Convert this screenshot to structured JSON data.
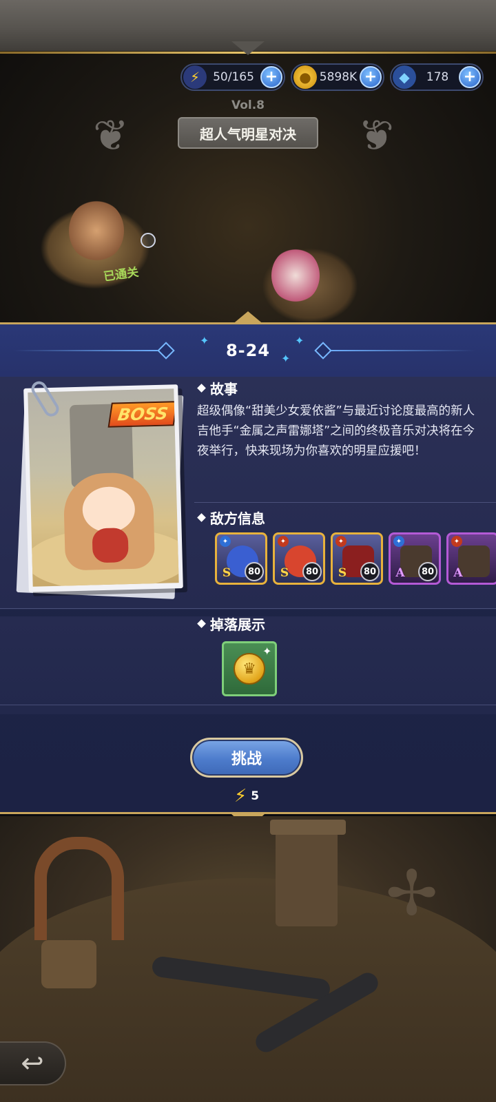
{
  "currency": {
    "energy": "50/165",
    "gold": "5898K",
    "gems": "178"
  },
  "chapter": {
    "volume": "Vol.8",
    "name": "超人气明星对决"
  },
  "map": {
    "cleared_label": "已通关"
  },
  "stage": {
    "id": "8-24",
    "boss_tag": "BOSS",
    "story_heading": "故事",
    "story_text": "超级偶像“甜美少女爱依酱”与最近讨论度最高的新人吉他手“金属之声雷娜塔”之间的终极音乐对决将在今夜举行，快来现场为你喜欢的明星应援吧！",
    "enemy_heading": "敌方信息",
    "enemies": [
      {
        "rank": "S",
        "level": "80",
        "frame": "gold",
        "portrait_color": "#3a5fd1"
      },
      {
        "rank": "S",
        "level": "80",
        "frame": "gold",
        "portrait_color": "#d8452e"
      },
      {
        "rank": "S",
        "level": "80",
        "frame": "gold",
        "portrait_color": "#8b1f1f"
      },
      {
        "rank": "A",
        "level": "80",
        "frame": "purple",
        "portrait_color": "#4a3a2e"
      },
      {
        "rank": "A",
        "level": "",
        "frame": "purple",
        "portrait_color": "#4a3a2e"
      }
    ],
    "drop_heading": "掉落展示",
    "drops": [
      {
        "icon": "gold-coin-icon"
      }
    ],
    "challenge_label": "挑战",
    "energy_cost": "5"
  },
  "colors": {
    "panel_bg": "#1e2547",
    "gold_trim": "#c9a65c",
    "button_blue": "#4d7ccc"
  }
}
